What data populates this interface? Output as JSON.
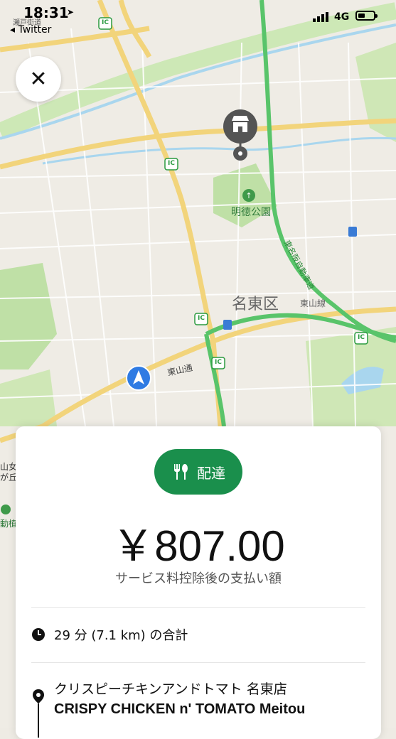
{
  "status_bar": {
    "time": "18:31",
    "back_app": "◂ Twitter",
    "network": "4G"
  },
  "map": {
    "labels": {
      "park": "明徳公園",
      "ward": "名東区",
      "road_higashiyama_dori": "東山通",
      "road_higashiyama_line": "東山線",
      "highway": "東名阪自動車道",
      "ic_badge": "IC",
      "left_edge_1": "山女",
      "left_edge_2": "が丘",
      "left_edge_3": "動植",
      "top_left_road": "瀬戸街道"
    }
  },
  "close_button": {
    "icon": "close-icon",
    "glyph": "✕"
  },
  "card": {
    "badge_label": "配達",
    "badge_icon": "fork-knife-icon",
    "price": "￥807.00",
    "subtitle": "サービス料控除後の支払い額",
    "trip_summary": "29 分 (7.1 km) の合計",
    "stop_name_ja": "クリスピーチキンアンドトマト 名東店",
    "stop_name_en": "CRISPY CHICKEN n' TOMATO Meitou"
  },
  "colors": {
    "badge_green": "#1a8f4c",
    "highway_green": "#59c46a",
    "main_road_yellow": "#f2d47b",
    "park_green": "#bfe0a6",
    "water_blue": "#a9d6ee",
    "nav_arrow_blue": "#2f7be3"
  }
}
